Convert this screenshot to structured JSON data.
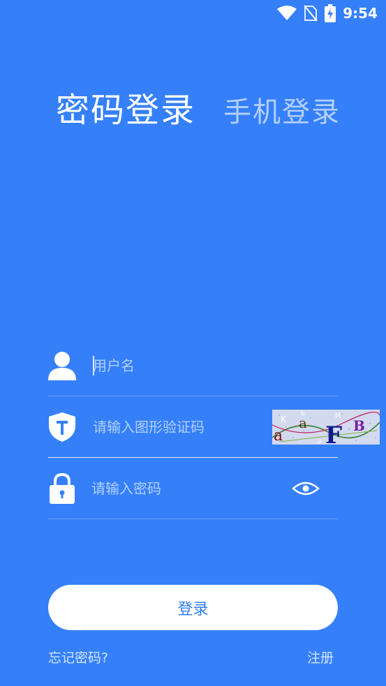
{
  "status_bar": {
    "time": "9:54"
  },
  "tabs": {
    "active": "密码登录",
    "inactive": "手机登录"
  },
  "form": {
    "username_placeholder": "用户名",
    "captcha_placeholder": "请输入图形验证码",
    "captcha_chars": [
      "a",
      "a",
      "F",
      "B",
      "H",
      "b",
      "u",
      "K"
    ],
    "password_placeholder": "请输入密码"
  },
  "login_label": "登录",
  "forgot_label": "忘记密码?",
  "register_label": "注册",
  "colors": {
    "background": "#3580f8",
    "button_text": "#2f7cf5"
  }
}
